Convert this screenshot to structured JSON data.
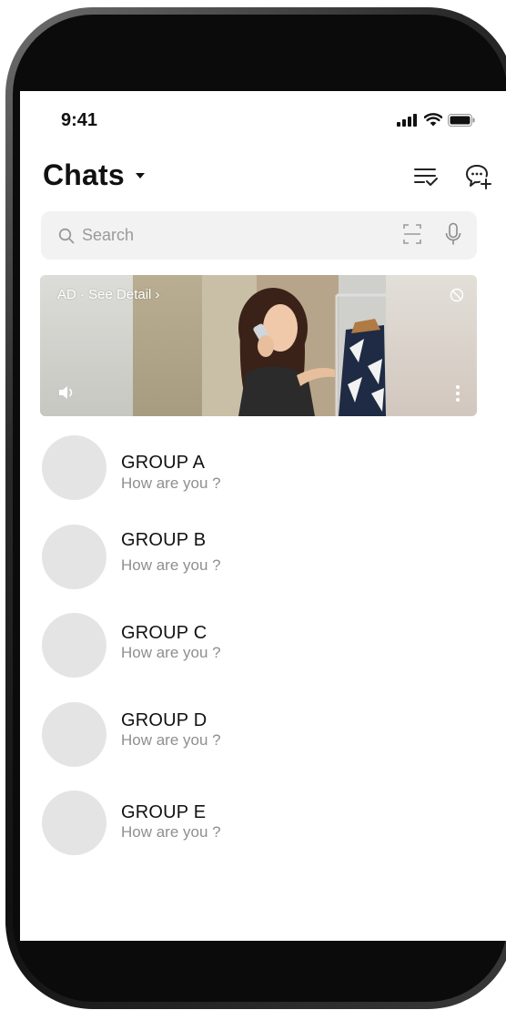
{
  "status_bar": {
    "time": "9:41"
  },
  "header": {
    "title": "Chats"
  },
  "search": {
    "placeholder": "Search"
  },
  "ad": {
    "label": "AD · See Detail ›"
  },
  "chats": [
    {
      "name": "GROUP A",
      "preview": "How are you ?"
    },
    {
      "name": "GROUP B",
      "preview": "How are you ?"
    },
    {
      "name": "GROUP C",
      "preview": "How are you ?"
    },
    {
      "name": "GROUP D",
      "preview": "How are you ?"
    },
    {
      "name": "GROUP E",
      "preview": "How are you ?"
    }
  ],
  "colors": {
    "avatar_placeholder": "#e4e4e4",
    "search_background": "#f2f2f2",
    "secondary_text": "#8f8f8f",
    "primary_text": "#111111"
  },
  "icons": {
    "status": [
      "signal-icon",
      "wifi-icon",
      "battery-icon"
    ],
    "header": [
      "edit-list-icon",
      "new-chat-icon"
    ],
    "search": [
      "search-icon",
      "scan-icon",
      "microphone-icon"
    ],
    "ad": [
      "hide-ad-icon",
      "speaker-icon",
      "more-vertical-icon"
    ]
  }
}
